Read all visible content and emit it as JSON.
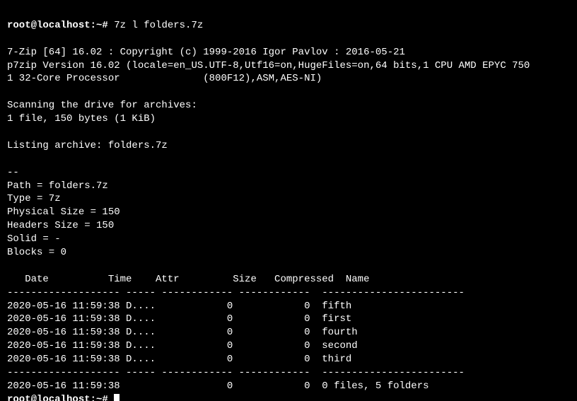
{
  "prompt1": "root@localhost:~# ",
  "command": "7z l folders.7z",
  "banner1": "7-Zip [64] 16.02 : Copyright (c) 1999-2016 Igor Pavlov : 2016-05-21",
  "banner2": "p7zip Version 16.02 (locale=en_US.UTF-8,Utf16=on,HugeFiles=on,64 bits,1 CPU AMD EPYC 750",
  "banner3": "1 32-Core Processor              (800F12),ASM,AES-NI)",
  "scan1": "Scanning the drive for archives:",
  "scan2": "1 file, 150 bytes (1 KiB)",
  "listing": "Listing archive: folders.7z",
  "dashes": "--",
  "meta": {
    "path": "Path = folders.7z",
    "type": "Type = 7z",
    "physical": "Physical Size = 150",
    "headers": "Headers Size = 150",
    "solid": "Solid = -",
    "blocks": "Blocks = 0"
  },
  "header": {
    "date": "Date",
    "time": "Time",
    "attr": "Attr",
    "size": "Size",
    "compressed": "Compressed",
    "name": "Name"
  },
  "rule": "------------------- ----- ------------ ------------  ------------------------",
  "rows": [
    {
      "date": "2020-05-16",
      "time": "11:59:38",
      "attr": "D....",
      "size": "0",
      "compressed": "0",
      "name": "fifth"
    },
    {
      "date": "2020-05-16",
      "time": "11:59:38",
      "attr": "D....",
      "size": "0",
      "compressed": "0",
      "name": "first"
    },
    {
      "date": "2020-05-16",
      "time": "11:59:38",
      "attr": "D....",
      "size": "0",
      "compressed": "0",
      "name": "fourth"
    },
    {
      "date": "2020-05-16",
      "time": "11:59:38",
      "attr": "D....",
      "size": "0",
      "compressed": "0",
      "name": "second"
    },
    {
      "date": "2020-05-16",
      "time": "11:59:38",
      "attr": "D....",
      "size": "0",
      "compressed": "0",
      "name": "third"
    }
  ],
  "summary": {
    "date": "2020-05-16",
    "time": "11:59:38",
    "attr": "",
    "size": "0",
    "compressed": "0",
    "name": "0 files, 5 folders"
  },
  "prompt2": "root@localhost:~# "
}
